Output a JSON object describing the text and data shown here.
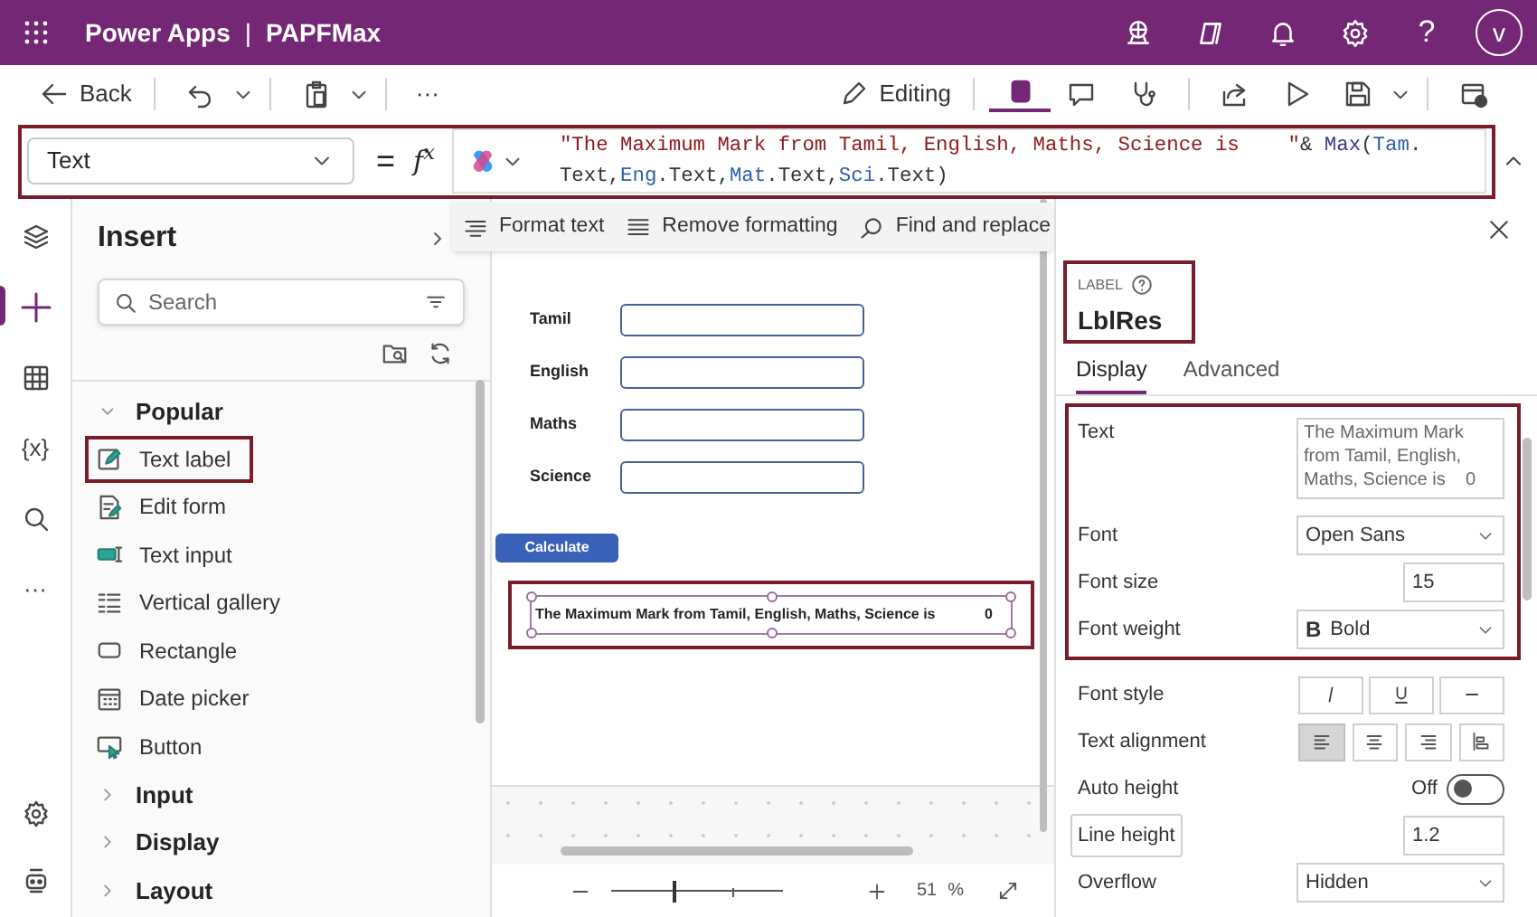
{
  "app_bar": {
    "product": "Power Apps",
    "separator": "|",
    "app_name": "PAPFMax",
    "help": "?",
    "avatar": "v"
  },
  "toolbar": {
    "back": "Back",
    "more": "···",
    "editing": "Editing"
  },
  "formula_bar": {
    "property": "Text",
    "equals": "=",
    "fx": "f$^{x}$",
    "highlighted": true,
    "lines": [
      [
        {
          "kind": "string",
          "text": "\"The Maximum Mark from Tamil, English, Maths, Science is    \""
        },
        {
          "kind": "plain",
          "text": "& "
        },
        {
          "kind": "function",
          "text": "Max"
        },
        {
          "kind": "plain",
          "text": "("
        },
        {
          "kind": "identifier",
          "text": "Tam"
        },
        {
          "kind": "plain",
          "text": "."
        }
      ],
      [
        {
          "kind": "plain",
          "text": "Text,"
        },
        {
          "kind": "identifier",
          "text": "Eng"
        },
        {
          "kind": "plain",
          "text": ".Text,"
        },
        {
          "kind": "identifier",
          "text": "Mat"
        },
        {
          "kind": "plain",
          "text": ".Text,"
        },
        {
          "kind": "identifier",
          "text": "Sci"
        },
        {
          "kind": "plain",
          "text": ".Text)"
        }
      ]
    ]
  },
  "formula_menu": [
    {
      "kind": "format",
      "label": "Format text"
    },
    {
      "kind": "remove",
      "label": "Remove formatting"
    },
    {
      "kind": "find",
      "label": "Find and replace"
    }
  ],
  "rail": [
    {
      "kind": "layers",
      "selected": false
    },
    {
      "kind": "insert",
      "selected": true
    },
    {
      "kind": "data",
      "selected": false
    },
    {
      "kind": "variables",
      "glyph": "{x}",
      "selected": false
    },
    {
      "kind": "search",
      "selected": false
    },
    {
      "kind": "more",
      "glyph": "···",
      "selected": false
    }
  ],
  "insert_panel": {
    "title": "Insert",
    "search": {
      "placeholder": "Search"
    },
    "groups": [
      {
        "label": "Popular",
        "expanded": true,
        "items": [
          {
            "kind": "label",
            "label": "Text label",
            "highlighted": true
          },
          {
            "kind": "form",
            "label": "Edit form",
            "highlighted": false
          },
          {
            "kind": "input",
            "label": "Text input",
            "highlighted": false
          },
          {
            "kind": "gallery",
            "label": "Vertical gallery",
            "highlighted": false
          },
          {
            "kind": "rectangle",
            "label": "Rectangle",
            "highlighted": false
          },
          {
            "kind": "date",
            "label": "Date picker",
            "highlighted": false
          },
          {
            "kind": "button",
            "label": "Button",
            "highlighted": false
          }
        ]
      },
      {
        "label": "Input",
        "expanded": false
      },
      {
        "label": "Display",
        "expanded": false
      },
      {
        "label": "Layout",
        "expanded": false
      }
    ]
  },
  "canvas": {
    "fields": [
      {
        "label": "Tamil"
      },
      {
        "label": "English"
      },
      {
        "label": "Maths"
      },
      {
        "label": "Science"
      }
    ],
    "button": "Calculate",
    "result": {
      "text": "The Maximum Mark from Tamil, English, Maths, Science is",
      "value": "0",
      "selected": true,
      "highlighted": true
    },
    "zoom": {
      "level": 0.37,
      "value": "51",
      "unit": "%"
    }
  },
  "properties_panel": {
    "control_type": "LABEL",
    "control_name": "LblRes",
    "highlighted": true,
    "tabs": [
      {
        "label": "Display",
        "selected": true
      },
      {
        "label": "Advanced",
        "selected": false
      }
    ],
    "property_groups": [
      {
        "highlighted": true,
        "properties": [
          {
            "kind": "textarea",
            "label": "Text",
            "value": "The Maximum Mark from Tamil, English, Maths, Science is    0",
            "hovered": false
          },
          {
            "kind": "dropdown",
            "label": "Font",
            "value": "Open Sans",
            "hovered": false
          },
          {
            "kind": "number",
            "label": "Font size",
            "value": "15",
            "hovered": false
          },
          {
            "kind": "dropdown",
            "label": "Font weight",
            "prefix": "B",
            "value": "Bold",
            "hovered": false
          }
        ]
      },
      {
        "highlighted": false,
        "properties": [
          {
            "kind": "style_buttons",
            "label": "Font style",
            "hovered": false
          },
          {
            "kind": "alignment",
            "label": "Text alignment",
            "options": [
              {
                "selected": true
              },
              {
                "selected": false
              },
              {
                "selected": false
              },
              {
                "selected": false
              }
            ],
            "hovered": false
          },
          {
            "kind": "toggle",
            "label": "Auto height",
            "state_label": "Off",
            "on": false,
            "hovered": false
          },
          {
            "kind": "number",
            "label": "Line height",
            "value": "1.2",
            "hovered": true
          },
          {
            "kind": "dropdown",
            "label": "Overflow",
            "value": "Hidden",
            "hovered": false
          }
        ]
      }
    ]
  }
}
